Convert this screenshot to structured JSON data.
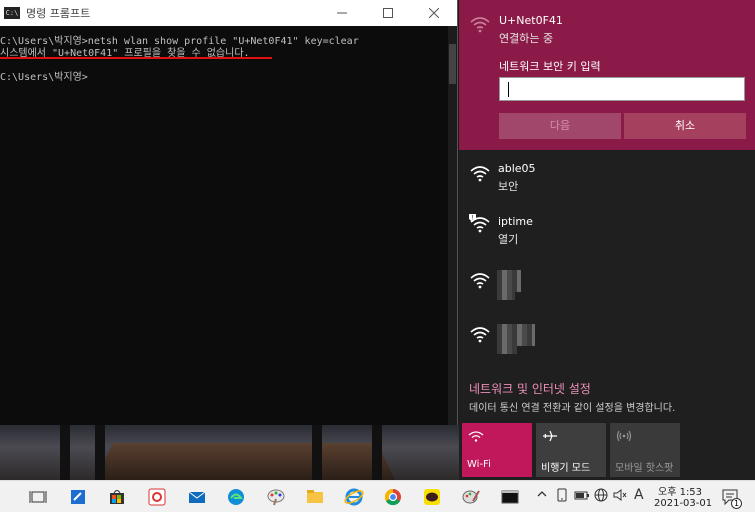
{
  "cmd": {
    "title": "명령 프롬프트",
    "lines": [
      "C:\\Users\\박지영>netsh wlan show profile \"U+Net0F41\" key=clear",
      "시스템에서 \"U+Net0F41\" 프로필을 찾을 수 없습니다.",
      "",
      "C:\\Users\\박지영>"
    ]
  },
  "flyout": {
    "active_network": {
      "ssid": "U+Net0F41",
      "status": "연결하는 중",
      "password_label": "네트워크 보안 키 입력",
      "password_value": "",
      "next_label": "다음",
      "cancel_label": "취소"
    },
    "networks": [
      {
        "ssid": "able05",
        "status": "보안",
        "icon": "wifi-secured-icon"
      },
      {
        "ssid": "iptime",
        "status": "열기",
        "icon": "wifi-open-warning-icon"
      },
      {
        "ssid": "",
        "status": "",
        "icon": "wifi-icon"
      },
      {
        "ssid": "",
        "status": "",
        "icon": "wifi-icon"
      }
    ],
    "settings_link": "네트워크 및 인터넷 설정",
    "settings_desc": "데이터 통신 연결 전환과 같이 설정을 변경합니다.",
    "quick_actions": [
      {
        "label": "Wi-Fi",
        "icon": "wifi-icon",
        "active": true
      },
      {
        "label": "비행기 모드",
        "icon": "airplane-icon",
        "active": false
      },
      {
        "label": "모바일 핫스팟",
        "icon": "hotspot-icon",
        "active": false
      }
    ]
  },
  "taskbar": {
    "ime_indicator": "A",
    "time": "오후 1:53",
    "date": "2021-03-01",
    "notification_count": "1"
  },
  "colors": {
    "accent": "#8c1a48",
    "wifi_tile": "#c1185b",
    "link": "#ee8fba"
  }
}
